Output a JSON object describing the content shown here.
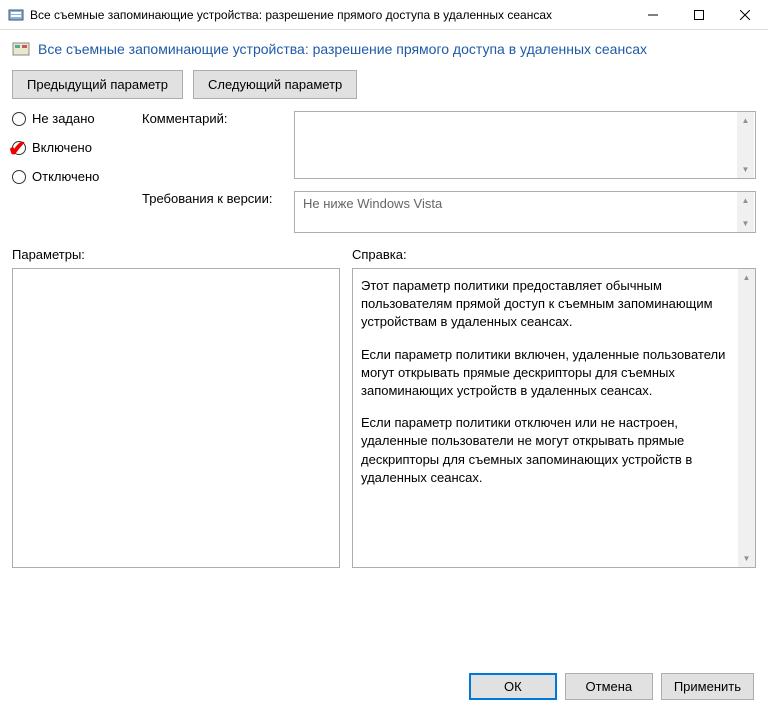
{
  "window": {
    "title": "Все съемные запоминающие устройства: разрешение прямого доступа в удаленных сеансах"
  },
  "header": {
    "text": "Все съемные запоминающие устройства: разрешение прямого доступа в удаленных сеансах"
  },
  "nav": {
    "prev": "Предыдущий параметр",
    "next": "Следующий параметр"
  },
  "radios": {
    "not_configured": "Не задано",
    "enabled": "Включено",
    "disabled": "Отключено"
  },
  "labels": {
    "comment": "Комментарий:",
    "version": "Требования к версии:",
    "params": "Параметры:",
    "help": "Справка:"
  },
  "fields": {
    "comment": "",
    "version": "Не ниже Windows Vista"
  },
  "help": {
    "p1": "Этот параметр политики предоставляет обычным пользователям прямой доступ к съемным запоминающим устройствам в удаленных сеансах.",
    "p2": "Если параметр политики включен, удаленные пользователи могут открывать прямые дескрипторы для съемных запоминающих устройств в удаленных сеансах.",
    "p3": "Если параметр политики отключен или не настроен, удаленные пользователи не могут открывать прямые дескрипторы для съемных запоминающих устройств в удаленных сеансах."
  },
  "footer": {
    "ok": "ОК",
    "cancel": "Отмена",
    "apply": "Применить"
  }
}
